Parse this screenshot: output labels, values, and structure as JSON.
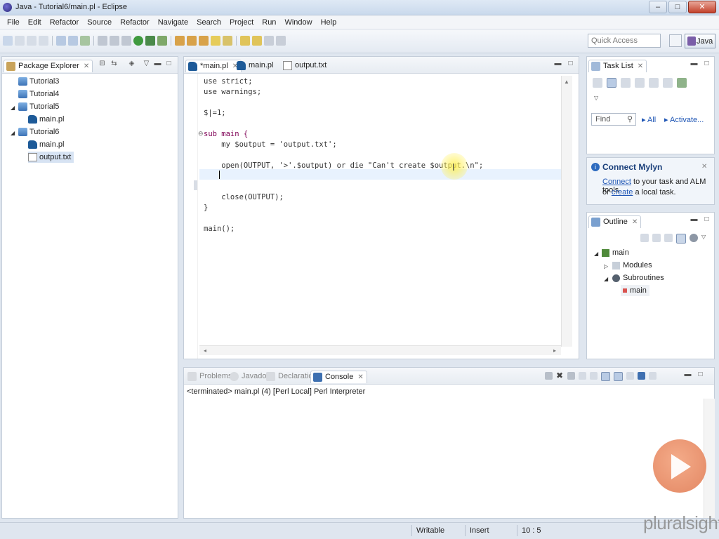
{
  "window": {
    "title": "Java - Tutorial6/main.pl - Eclipse",
    "minimize": "–",
    "maximize": "□",
    "close": "✕"
  },
  "menu": [
    "File",
    "Edit",
    "Refactor",
    "Source",
    "Refactor",
    "Navigate",
    "Search",
    "Project",
    "Run",
    "Window",
    "Help"
  ],
  "toolbar": {
    "quick_access_placeholder": "Quick Access",
    "perspective": "Java"
  },
  "package_explorer": {
    "title": "Package Explorer",
    "items": [
      {
        "label": "Tutorial3",
        "icon": "project-icon"
      },
      {
        "label": "Tutorial4",
        "icon": "project-icon"
      },
      {
        "label": "Tutorial5",
        "icon": "project-icon"
      },
      {
        "label": "main.pl",
        "icon": "perl-file-icon"
      },
      {
        "label": "Tutorial6",
        "icon": "project-icon"
      },
      {
        "label": "main.pl",
        "icon": "perl-file-icon"
      },
      {
        "label": "output.txt",
        "icon": "text-file-icon"
      }
    ]
  },
  "editor": {
    "tabs": [
      "*main.pl",
      "main.pl",
      "output.txt"
    ],
    "lines": [
      "use strict;",
      "use warnings;",
      "",
      "$|=1;",
      "",
      "sub main {",
      "    my $output = 'output.txt';",
      "",
      "    open(OUTPUT, '>'.$output) or die \"Can't create $output.\\n\";",
      "",
      "",
      "    close(OUTPUT);",
      "}",
      "",
      "main();"
    ]
  },
  "task_list": {
    "title": "Task List",
    "find_placeholder": "Find",
    "all": "All",
    "activate": "Activate..."
  },
  "mylyn": {
    "title": "Connect Mylyn",
    "line1_link": "Connect",
    "line1_rest": " to your task and ALM tools",
    "line2_pre": "or ",
    "line2_link": "create",
    "line2_rest": " a local task."
  },
  "outline": {
    "title": "Outline",
    "root": "main",
    "modules": "Modules",
    "subroutines": "Subroutines",
    "sub_main": "main"
  },
  "bottom": {
    "tabs": [
      "Problems",
      "Javadoc",
      "Declaration",
      "Console"
    ],
    "console_header": "<terminated> main.pl (4) [Perl Local] Perl Interpreter"
  },
  "status": {
    "writable": "Writable",
    "insert": "Insert",
    "position": "10 : 5"
  },
  "watermark": {
    "text": "pluralsight"
  },
  "colors": {
    "accent": "#1f56b5",
    "keyword": "#7f0055",
    "string": "#2a00ff",
    "brand": "#e07a52"
  }
}
